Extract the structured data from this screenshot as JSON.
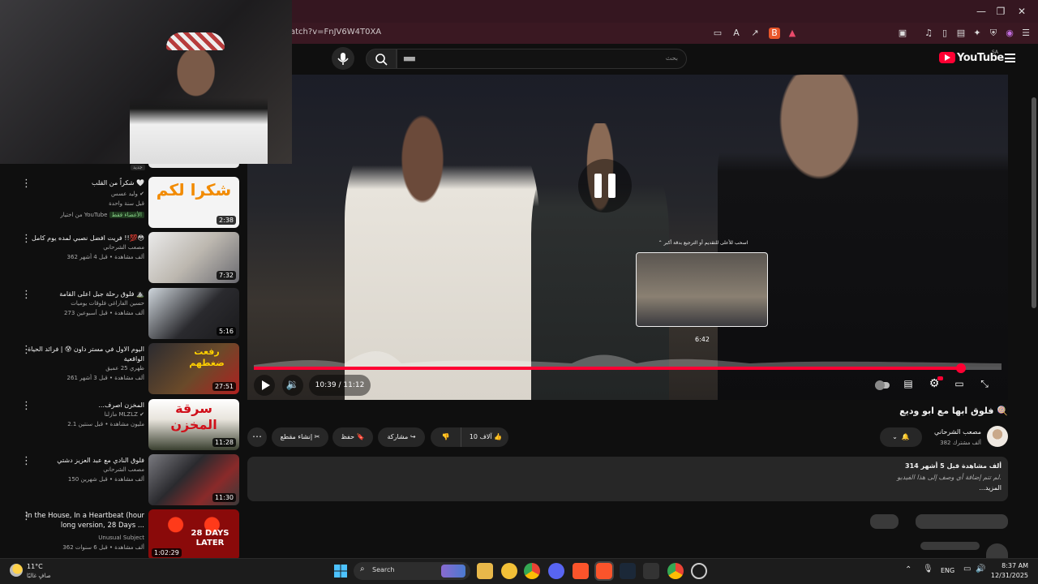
{
  "browser": {
    "url": "atch?v=FnJV6W4T0XA",
    "window_controls": {
      "minimize": "—",
      "restore": "❐",
      "close": "✕"
    }
  },
  "youtube": {
    "logo": "YouTube",
    "logo_region": "SA",
    "search_placeholder": "بحث",
    "search_value": "▄▄"
  },
  "player": {
    "time_current": "10:39",
    "time_sep": "/",
    "time_total": "11:12",
    "progress_fraction": 0.946,
    "preview_hint": "اسحب للأعلى للتقديم أو الترجيع بدقة أكبر",
    "preview_time": "6:42",
    "accent": "#ff0033"
  },
  "video": {
    "title": "فلوق ابها مع ابو وديع 🍭",
    "channel": "مصعب الشرحاني",
    "subscribers": "382 ألف مشترك",
    "likes": "10 آلاف",
    "share": "مشاركة",
    "save": "حفظ",
    "clip": "إنشاء مقطع",
    "views_date": "314 ألف مشاهدة قبل 5 أشهر",
    "desc_empty": "لم تتم إضافة أي وصف إلى هذا الفيديو.",
    "more": "...المزيد"
  },
  "sidebar": {
    "top_badge": "جديد",
    "items": [
      {
        "title": "شكراً من القلب 🤍",
        "channel": "وليد عسس ✔",
        "meta": "قبل سنة واحدة",
        "extra": "من اختيار YouTube",
        "extra_badge": "الأعضاء فقط",
        "duration": "2:38",
        "thumb_text": "شكرا لكم"
      },
      {
        "title": "فريت افضل نصبي لمده يوم كامل !!💯😳",
        "channel": "مصعب الشرحاني",
        "meta": "362 ألف مشاهدة • قبل 4 أشهر",
        "duration": "7:32"
      },
      {
        "title": "فلوق رحلة جبل اعلى القامة ⛰️",
        "channel": "حسين الفاراغي فلوقات يوميات",
        "meta": "273 ألف مشاهدة • قبل أسبوعين",
        "duration": "5:16"
      },
      {
        "title": "اليوم الاول في مستر داون 😰 | فرائد الحياة الواقعية",
        "channel": "ظهري 25 عميق",
        "meta": "261 ألف مشاهدة • قبل 3 أشهر",
        "duration": "27:51",
        "thumb_text": "رفعت ضغطهم"
      },
      {
        "title": "...المخزن اصرف",
        "channel": "مازلنا MLZLZ ✔",
        "meta": "2.1 مليون مشاهدة • قبل سنتين",
        "duration": "11:28",
        "thumb_text": "سرقة المخزن"
      },
      {
        "title": "فلوق النادي مع عبد العزيز دشتي",
        "channel": "مصعب الشرحاني",
        "meta": "150 ألف مشاهدة • قبل شهرين",
        "duration": "11:30"
      },
      {
        "title": "In the House, In a Heartbeat (hour long version, 28 Days ...",
        "channel": "Unusual Subject",
        "meta": "362 ألف مشاهدة • قبل 6 سنوات",
        "duration": "1:02:29",
        "thumb_text": "28 DAYS LATER"
      }
    ]
  },
  "taskbar": {
    "weather_temp": "11°C",
    "weather_desc": "صافٍ غالبًا",
    "search": "Search",
    "lang": "ENG",
    "time": "8:37 AM",
    "date": "12/31/2025"
  }
}
